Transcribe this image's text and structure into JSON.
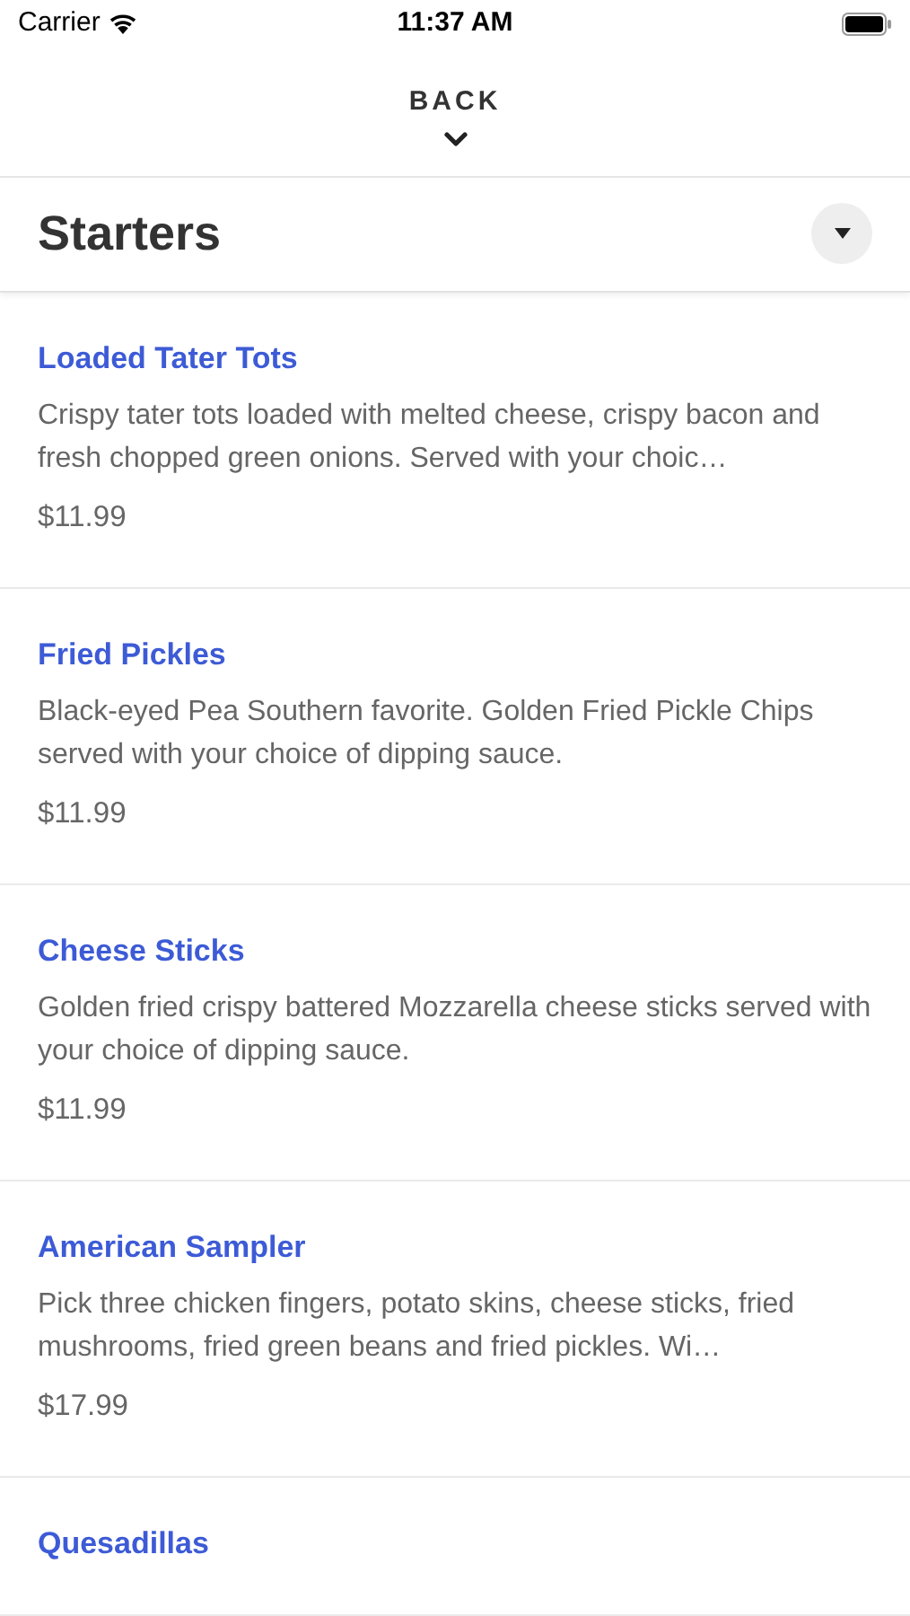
{
  "status_bar": {
    "carrier": "Carrier",
    "time": "11:37 AM"
  },
  "nav": {
    "back": "BACK"
  },
  "section": {
    "title": "Starters"
  },
  "items": [
    {
      "name": "Loaded Tater Tots",
      "description": "Crispy tater tots loaded with melted cheese, crispy bacon and fresh chopped green onions. Served with your choic…",
      "price": "$11.99"
    },
    {
      "name": "Fried Pickles",
      "description": "Black-eyed Pea Southern favorite. Golden Fried Pickle Chips served with your choice of dipping sauce.",
      "price": "$11.99"
    },
    {
      "name": "Cheese Sticks",
      "description": "Golden fried crispy battered Mozzarella cheese sticks served with your choice of dipping sauce.",
      "price": "$11.99"
    },
    {
      "name": "American Sampler",
      "description": "Pick three chicken fingers, potato skins, cheese sticks, fried mushrooms, fried green beans and fried pickles. Wi…",
      "price": "$17.99"
    },
    {
      "name": "Quesadillas"
    }
  ]
}
